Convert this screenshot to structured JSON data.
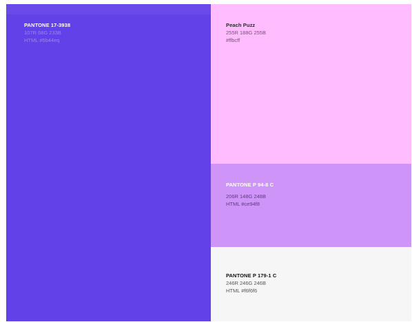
{
  "swatches": [
    {
      "name": "PANTONE 17-3938",
      "rgb": "107R 68G 233B",
      "html": "HTML #6b44eq",
      "color": "#6241e8"
    },
    {
      "name": "Peach Puzz",
      "rgb": "255R 188G 255B",
      "html": "#ffbcff",
      "color": "#ffbcff"
    },
    {
      "name": "PANTONE P 94-8 C",
      "rgb": "206R 148G 248B",
      "html": "HTML #ce94f8",
      "color": "#ce94f8"
    },
    {
      "name": "PANTONE P 179-1 C",
      "rgb": "246R 246G 246B",
      "html": "HTML #f6f6f6",
      "color": "#f6f6f6"
    }
  ]
}
